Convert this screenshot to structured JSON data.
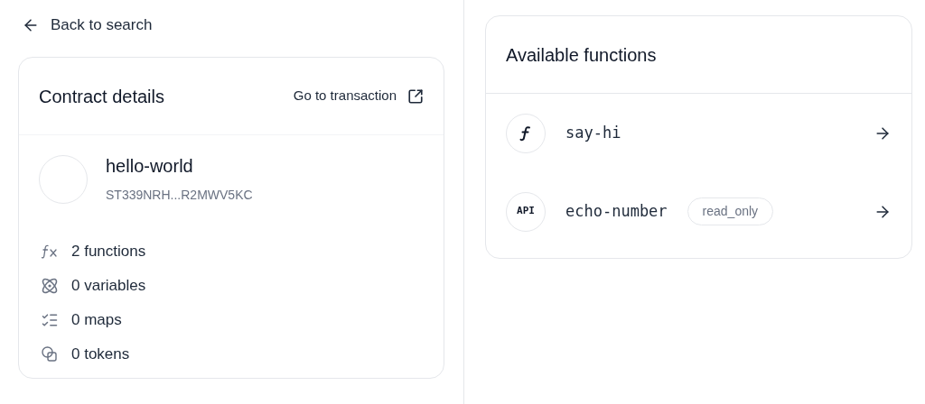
{
  "back_link": {
    "label": "Back to search"
  },
  "contract_card": {
    "title": "Contract details",
    "action": "Go to transaction",
    "name": "hello-world",
    "address": "ST339NRH...R2MWV5KC",
    "stats": [
      {
        "kind": "functions",
        "label": "2 functions"
      },
      {
        "kind": "variables",
        "label": "0 variables"
      },
      {
        "kind": "maps",
        "label": "0 maps"
      },
      {
        "kind": "tokens",
        "label": "0 tokens"
      }
    ]
  },
  "functions_card": {
    "title": "Available functions",
    "functions": [
      {
        "kind": "function",
        "name": "say-hi"
      },
      {
        "kind": "api",
        "icon_label": "API",
        "name": "echo-number",
        "badge": "read_only"
      }
    ]
  }
}
